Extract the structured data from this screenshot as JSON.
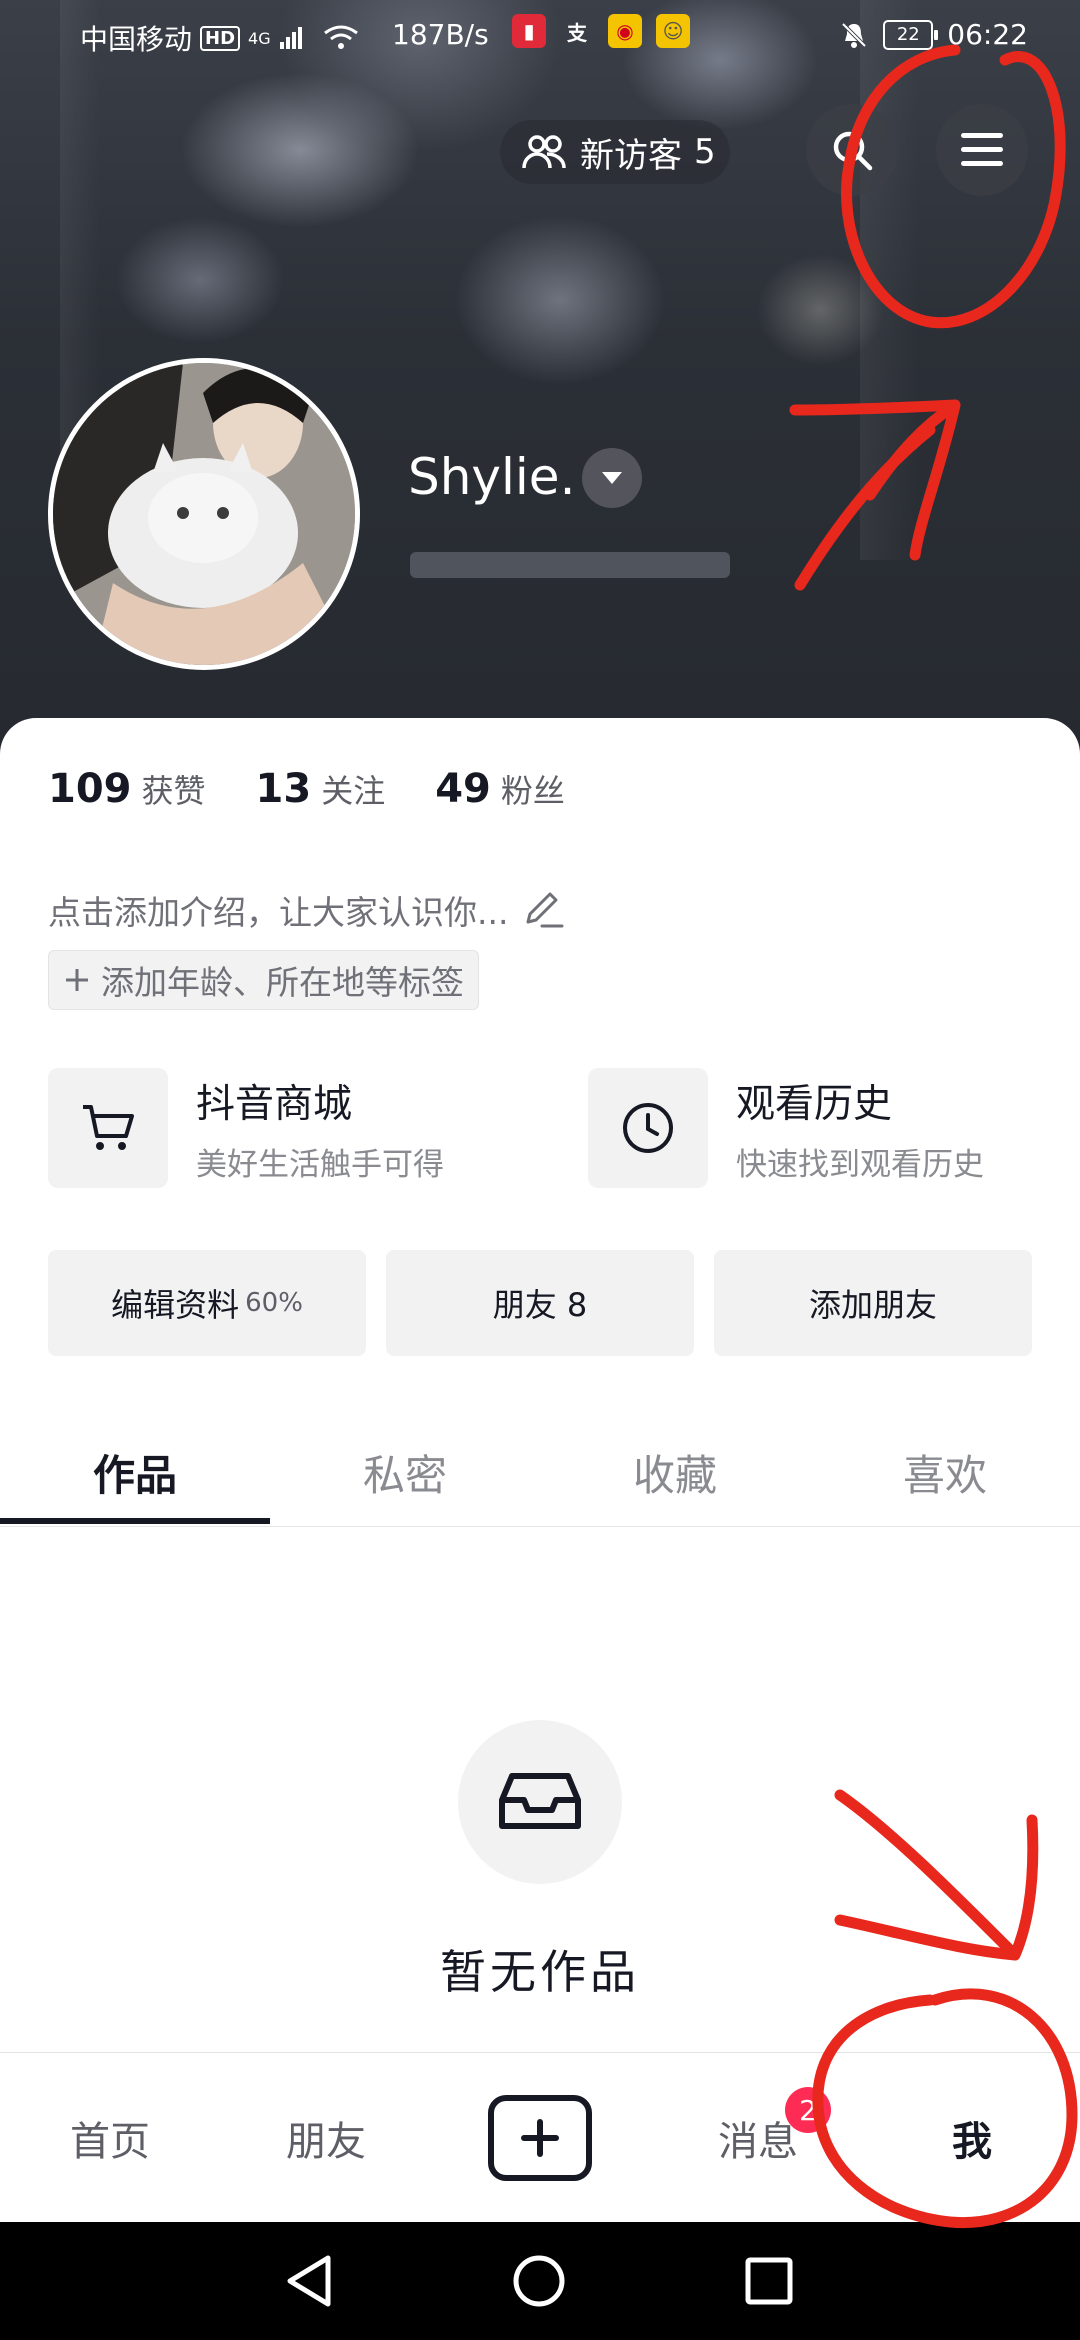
{
  "status_bar": {
    "carrier": "中国移动",
    "hd": "HD",
    "signal": "4G",
    "speed": "187B/s",
    "battery": "22",
    "time": "06:22"
  },
  "header": {
    "visitors_label": "新访客",
    "visitors_count": "5",
    "nickname": "Shylie."
  },
  "profile": {
    "stats": [
      {
        "value": "109",
        "label": "获赞"
      },
      {
        "value": "13",
        "label": "关注"
      },
      {
        "value": "49",
        "label": "粉丝"
      }
    ],
    "bio_placeholder": "点击添加介绍，让大家认识你...",
    "tag_hint": "添加年龄、所在地等标签"
  },
  "features": [
    {
      "title": "抖音商城",
      "subtitle": "美好生活触手可得",
      "icon": "cart-icon"
    },
    {
      "title": "观看历史",
      "subtitle": "快速找到观看历史",
      "icon": "clock-icon"
    }
  ],
  "actions": {
    "edit": "编辑资料",
    "edit_pct": "60%",
    "friends": "朋友 8",
    "add_friend": "添加朋友"
  },
  "tabs": [
    "作品",
    "私密",
    "收藏",
    "喜欢"
  ],
  "active_tab": 0,
  "empty_state": "暂无作品",
  "bottom_nav": {
    "home": "首页",
    "friends": "朋友",
    "messages": "消息",
    "messages_badge": "2",
    "me": "我"
  },
  "colors": {
    "accent": "#fe2c55",
    "annotation": "#e8281c",
    "text": "#161823"
  }
}
